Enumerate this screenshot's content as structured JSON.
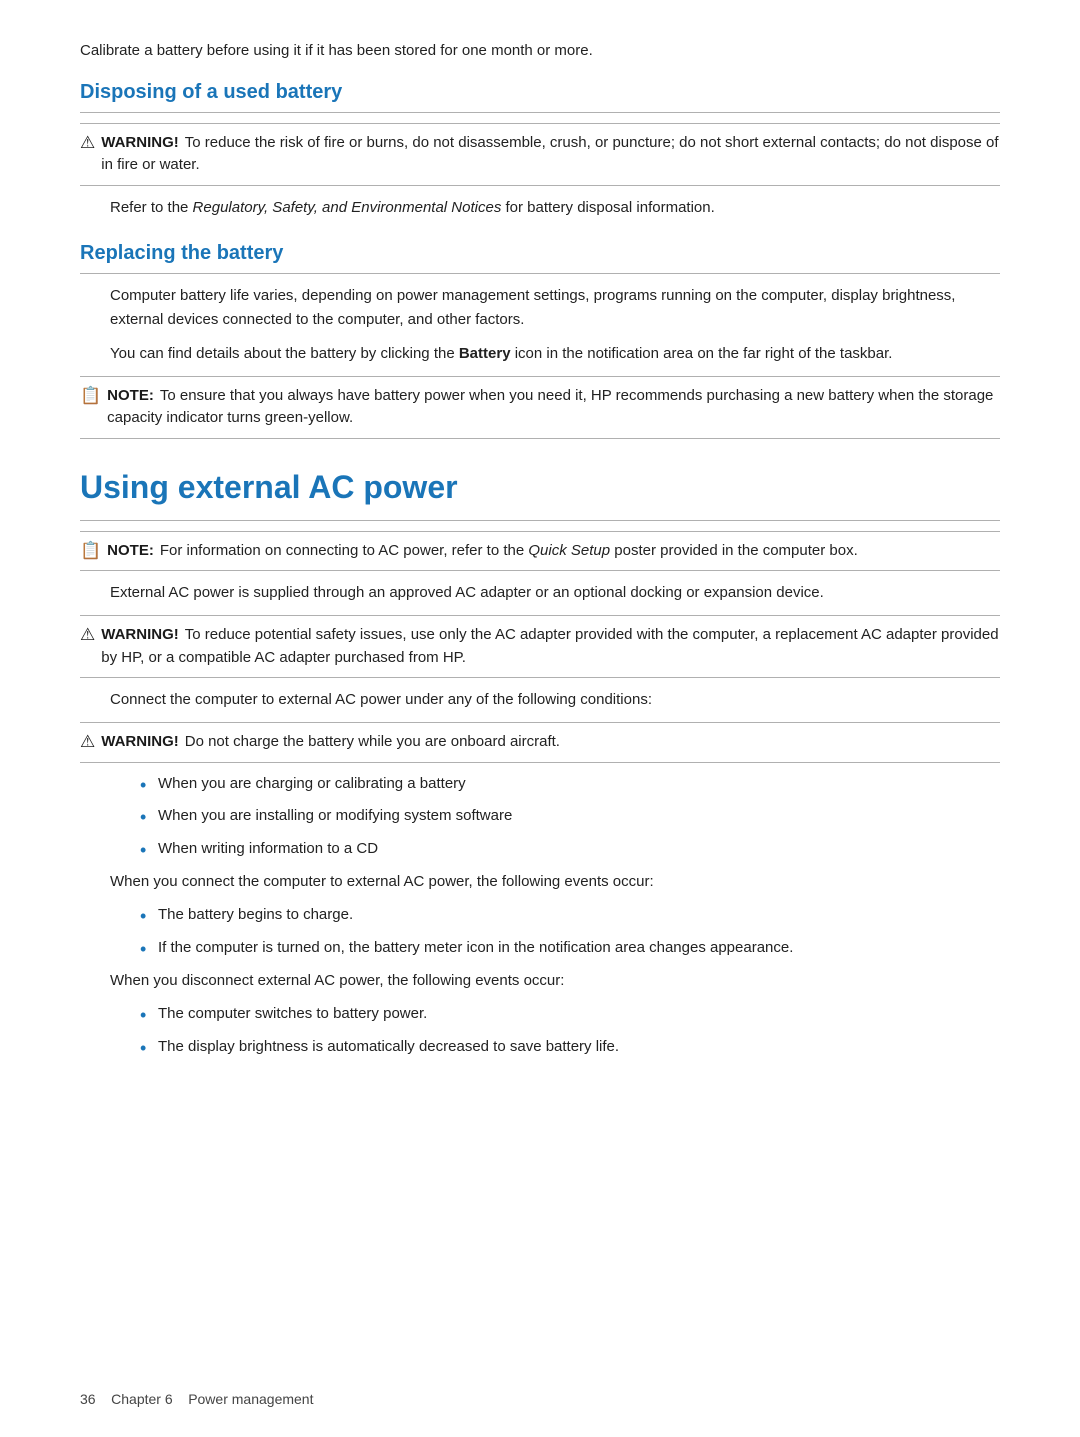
{
  "page": {
    "intro_text": "Calibrate a battery before using it if it has been stored for one month or more.",
    "section1": {
      "heading": "Disposing of a used battery",
      "warning": {
        "label": "WARNING!",
        "text": "To reduce the risk of fire or burns, do not disassemble, crush, or puncture; do not short external contacts; do not dispose of in fire or water."
      },
      "refer_text_prefix": "Refer to the ",
      "refer_text_italic": "Regulatory, Safety, and Environmental Notices",
      "refer_text_suffix": " for battery disposal information."
    },
    "section2": {
      "heading": "Replacing the battery",
      "body1": "Computer battery life varies, depending on power management settings, programs running on the computer, display brightness, external devices connected to the computer, and other factors.",
      "body2_prefix": "You can find details about the battery by clicking the ",
      "body2_bold": "Battery",
      "body2_suffix": " icon in the notification area on the far right of the taskbar.",
      "note": {
        "label": "NOTE:",
        "text": "To ensure that you always have battery power when you need it, HP recommends purchasing a new battery when the storage capacity indicator turns green-yellow."
      }
    },
    "section3": {
      "heading": "Using external AC power",
      "note": {
        "label": "NOTE:",
        "text_prefix": "For information on connecting to AC power, refer to the ",
        "text_italic": "Quick Setup",
        "text_suffix": " poster provided in the computer box."
      },
      "body1": "External AC power is supplied through an approved AC adapter or an optional docking or expansion device.",
      "warning1": {
        "label": "WARNING!",
        "text": "To reduce potential safety issues, use only the AC adapter provided with the computer, a replacement AC adapter provided by HP, or a compatible AC adapter purchased from HP."
      },
      "body2": "Connect the computer to external AC power under any of the following conditions:",
      "warning2": {
        "label": "WARNING!",
        "text": "Do not charge the battery while you are onboard aircraft."
      },
      "bullets1": [
        "When you are charging or calibrating a battery",
        "When you are installing or modifying system software",
        "When writing information to a CD"
      ],
      "body3": "When you connect the computer to external AC power, the following events occur:",
      "bullets2": [
        "The battery begins to charge.",
        "If the computer is turned on, the battery meter icon in the notification area changes appearance."
      ],
      "body4": "When you disconnect external AC power, the following events occur:",
      "bullets3": [
        "The computer switches to battery power.",
        "The display brightness is automatically decreased to save battery life."
      ]
    },
    "footer": {
      "page_num": "36",
      "chapter": "Chapter 6",
      "chapter_title": "Power management"
    }
  }
}
